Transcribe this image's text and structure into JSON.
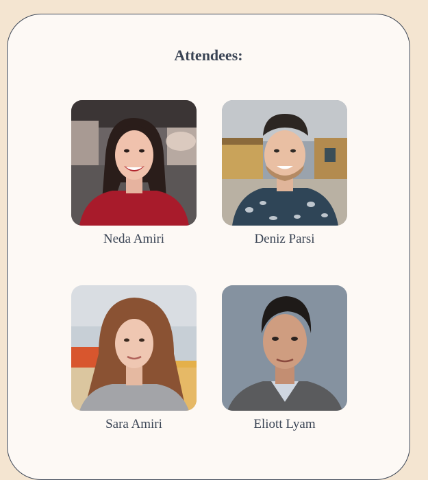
{
  "heading": "Attendees:",
  "attendees": [
    {
      "name": "Neda Amiri"
    },
    {
      "name": "Deniz Parsi"
    },
    {
      "name": "Sara Amiri"
    },
    {
      "name": "Eliott Lyam"
    }
  ]
}
